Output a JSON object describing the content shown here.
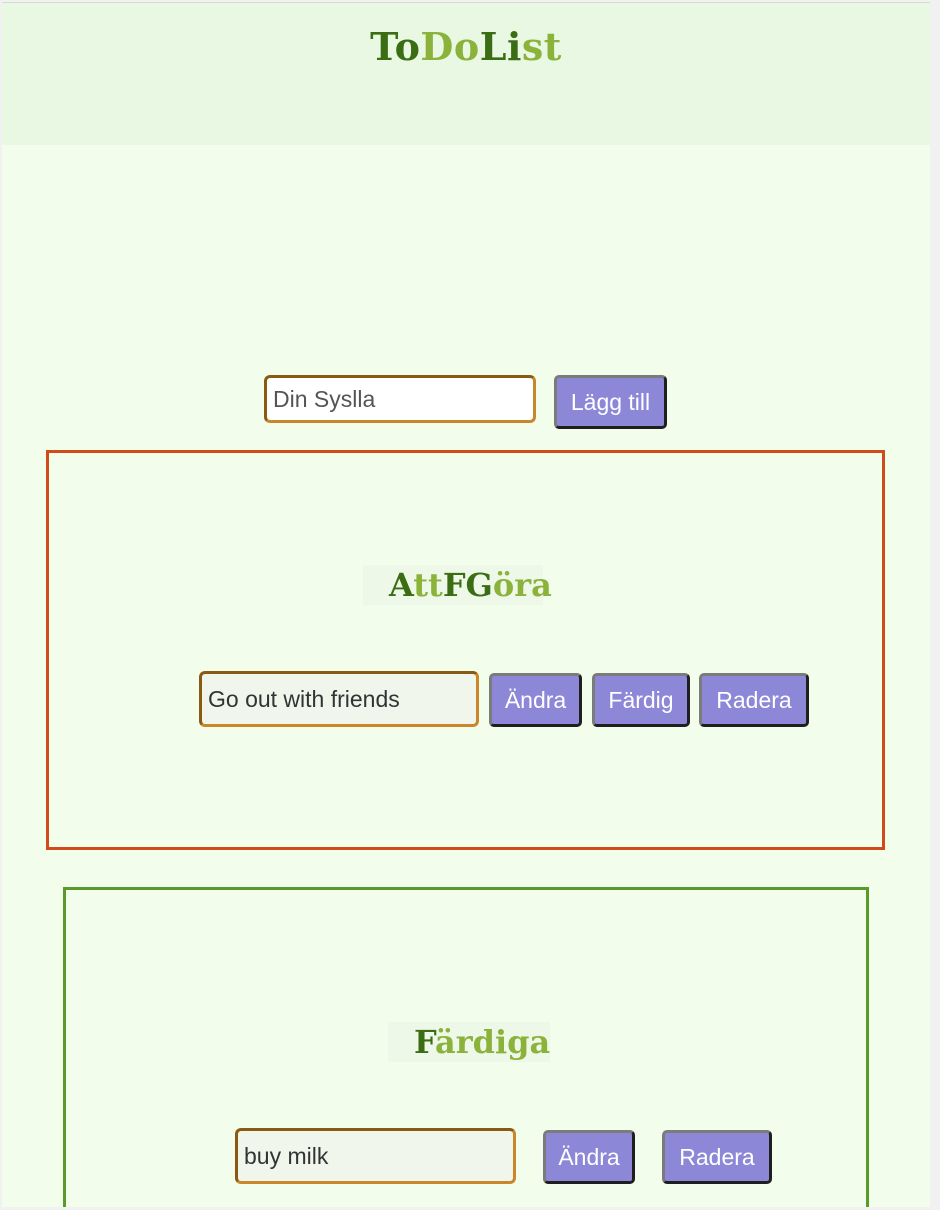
{
  "header": {
    "title_parts": [
      "To",
      "Do",
      "Li",
      "st"
    ],
    "colors": {
      "dark": "#3b6e14",
      "light": "#8bb23a"
    }
  },
  "add_form": {
    "input_placeholder": "Din Syslla",
    "add_button_label": "Lägg till"
  },
  "todo_section": {
    "heading_parts": [
      "A",
      "tt",
      "FG",
      "öra"
    ],
    "border_color": "#d04a1a",
    "items": [
      {
        "value": "Go out with friends",
        "edit_label": "Ändra",
        "done_label": "Färdig",
        "delete_label": "Radera"
      }
    ]
  },
  "done_section": {
    "heading_parts": [
      "F",
      "ärdiga"
    ],
    "border_color": "#5a9a2a",
    "items": [
      {
        "value": "buy milk",
        "edit_label": "Ändra",
        "delete_label": "Radera"
      }
    ]
  },
  "button_color": "#8d87d8"
}
